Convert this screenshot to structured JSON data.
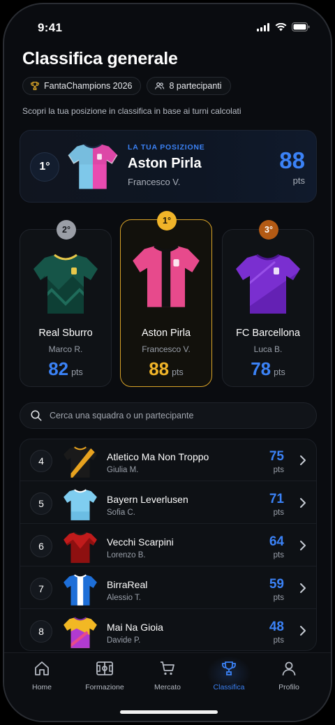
{
  "status": {
    "time": "9:41"
  },
  "page_title": "Classifica generale",
  "chips": {
    "league": "FantaChampions 2026",
    "participants": "8 partecipanti"
  },
  "subtitle": "Scopri la tua posizione in classifica in base ai turni calcolati",
  "my_position": {
    "rank": "1°",
    "label": "LA TUA POSIZIONE",
    "team": "Aston Pirla",
    "owner": "Francesco V.",
    "points": "88",
    "unit": "pts"
  },
  "podium": [
    {
      "rank": "2°",
      "team": "Real Sburro",
      "owner": "Marco R.",
      "points": "82",
      "unit": "pts",
      "accent": "#3b82f6",
      "badge_color": "#9a9ea6"
    },
    {
      "rank": "1°",
      "team": "Aston Pirla",
      "owner": "Francesco V.",
      "points": "88",
      "unit": "pts",
      "accent": "#f0b429",
      "badge_color": "#f0b429"
    },
    {
      "rank": "3°",
      "team": "FC Barcellona",
      "owner": "Luca B.",
      "points": "78",
      "unit": "pts",
      "accent": "#3b82f6",
      "badge_color": "#b35a14"
    }
  ],
  "search": {
    "placeholder": "Cerca una squadra o un partecipante"
  },
  "standings": [
    {
      "rank": "4",
      "team": "Atletico Ma Non Troppo",
      "owner": "Giulia M.",
      "points": "75",
      "unit": "pts"
    },
    {
      "rank": "5",
      "team": "Bayern Leverlusen",
      "owner": "Sofia C.",
      "points": "71",
      "unit": "pts"
    },
    {
      "rank": "6",
      "team": "Vecchi Scarpini",
      "owner": "Lorenzo B.",
      "points": "64",
      "unit": "pts"
    },
    {
      "rank": "7",
      "team": "BirraReal",
      "owner": "Alessio T.",
      "points": "59",
      "unit": "pts"
    },
    {
      "rank": "8",
      "team": "Mai Na Gioia",
      "owner": "Davide P.",
      "points": "48",
      "unit": "pts"
    }
  ],
  "tabs": [
    {
      "label": "Home",
      "icon": "home-icon"
    },
    {
      "label": "Formazione",
      "icon": "pitch-icon"
    },
    {
      "label": "Mercato",
      "icon": "cart-icon"
    },
    {
      "label": "Classifica",
      "icon": "trophy-icon",
      "active": true
    },
    {
      "label": "Profilo",
      "icon": "user-icon"
    }
  ],
  "colors": {
    "accent_blue": "#3b82f6",
    "gold": "#f0b429",
    "background": "#0a0c10"
  }
}
